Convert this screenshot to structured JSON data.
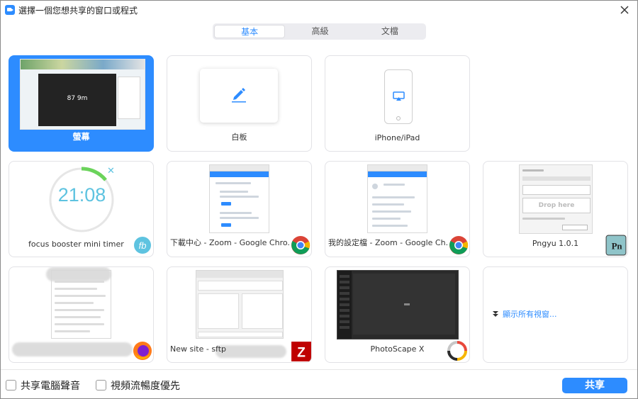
{
  "window": {
    "title": "選擇一個您想共享的窗口或程式"
  },
  "tabs": [
    {
      "label": "基本",
      "active": true
    },
    {
      "label": "高級",
      "active": false
    },
    {
      "label": "文檔",
      "active": false
    }
  ],
  "cards": {
    "screen": {
      "label": "螢幕",
      "video_text": "87 9m"
    },
    "whiteboard": {
      "label": "白板"
    },
    "iphone": {
      "label": "iPhone/iPad"
    },
    "focus": {
      "label": "focus booster mini timer",
      "timer_text": "21:08",
      "badge": "fb"
    },
    "chrome1": {
      "label": "下載中心 - Zoom - Google Chro..."
    },
    "chrome2": {
      "label": "我的設定檔 - Zoom - Google Ch..."
    },
    "pngyu": {
      "label": "Pngyu 1.0.1",
      "thumb_text": "Drop here"
    },
    "firefox": {
      "label": ""
    },
    "filezilla": {
      "label": "New site - sftp"
    },
    "photoscape": {
      "label": "PhotoScape X"
    },
    "show_all": {
      "label": "顯示所有視窗..."
    }
  },
  "bottom": {
    "share_audio": "共享電腦聲音",
    "optimize_video": "視頻流暢度優先",
    "share_button": "共享"
  },
  "colors": {
    "accent": "#2d8cff",
    "selected_card": "#2d8cff",
    "timer": "#5ec3e0",
    "timer_arc": "#6bd35b"
  },
  "icons": [
    "zoom-app-icon",
    "close-icon",
    "pen-icon",
    "airplay-icon",
    "chrome-icon",
    "firefox-icon",
    "filezilla-icon",
    "photoscape-icon",
    "pngyu-icon",
    "focus-booster-icon",
    "expand-down-icon"
  ]
}
